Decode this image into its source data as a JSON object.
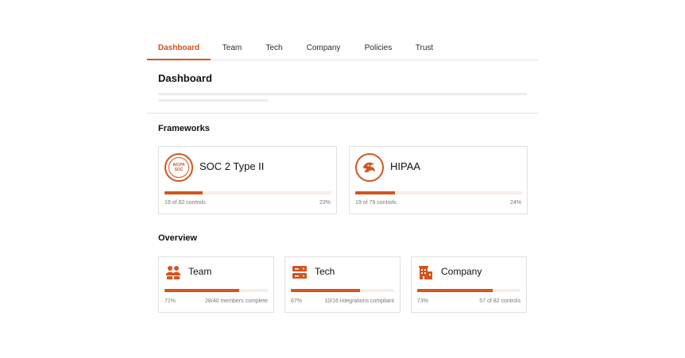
{
  "tabs": [
    {
      "label": "Dashboard",
      "active": true
    },
    {
      "label": "Team",
      "active": false
    },
    {
      "label": "Tech",
      "active": false
    },
    {
      "label": "Company",
      "active": false
    },
    {
      "label": "Policies",
      "active": false
    },
    {
      "label": "Trust",
      "active": false
    }
  ],
  "page_title": "Dashboard",
  "frameworks": {
    "title": "Frameworks",
    "items": [
      {
        "name": "SOC 2 Type II",
        "logo_text": [
          "AICPA",
          "SOC"
        ],
        "controls": "19 of 82 controls",
        "percent": "23%",
        "progress": 0.23
      },
      {
        "name": "HIPAA",
        "logo_text": [
          "HHS"
        ],
        "controls": "19 of 79 controls",
        "percent": "24%",
        "progress": 0.24
      }
    ]
  },
  "overview": {
    "title": "Overview",
    "items": [
      {
        "name": "Team",
        "icon": "people-icon",
        "percent": "72%",
        "detail": "28/40 members complete",
        "progress": 0.72
      },
      {
        "name": "Tech",
        "icon": "server-icon",
        "percent": "67%",
        "detail": "10/16 integrations compliant",
        "progress": 0.67
      },
      {
        "name": "Company",
        "icon": "building-icon",
        "percent": "73%",
        "detail": "57 of 82 controls",
        "progress": 0.73
      }
    ]
  },
  "colors": {
    "accent": "#d4541f",
    "track": "#f7ede8",
    "border": "#e1e1e1",
    "muted": "#777777"
  }
}
